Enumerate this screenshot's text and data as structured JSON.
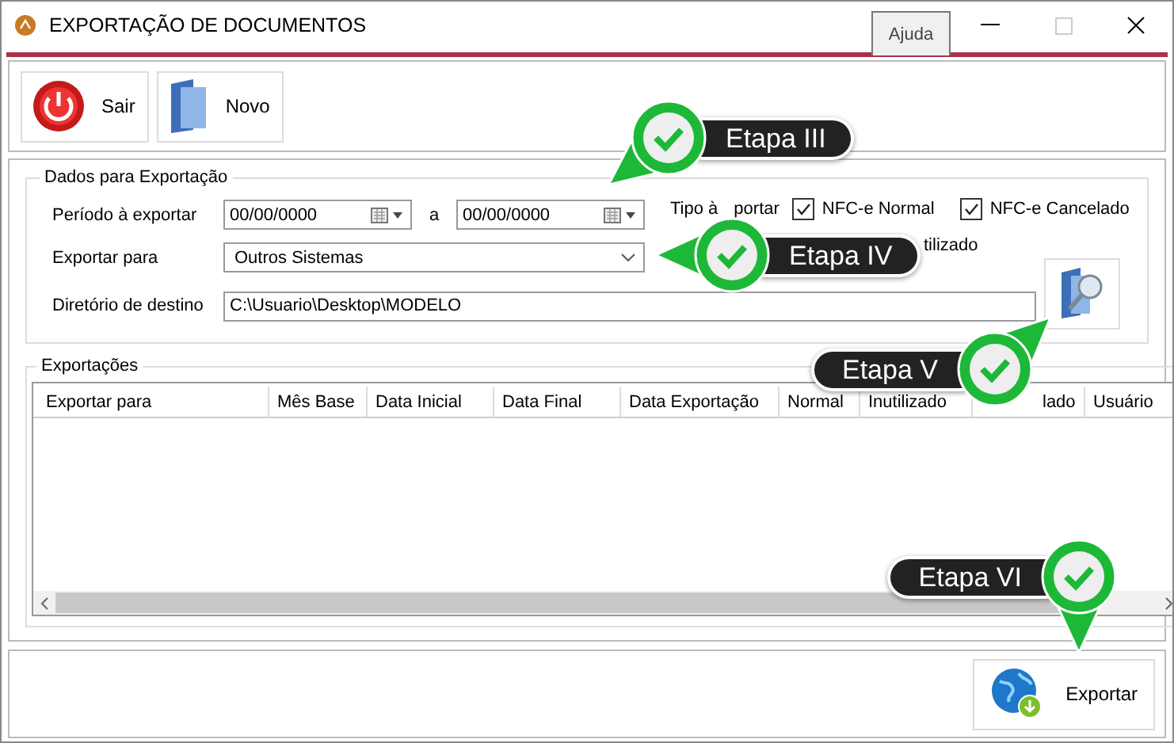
{
  "window": {
    "title": "EXPORTAÇÃO DE DOCUMENTOS",
    "help_tab": "Ajuda"
  },
  "toolbar": [
    {
      "label": "Sair",
      "kind": "exit"
    },
    {
      "label": "Novo",
      "kind": "new"
    }
  ],
  "export_data": {
    "title": "Dados para Exportação",
    "period_label": "Período à exportar",
    "date_from": "00/00/0000",
    "separator": "a",
    "date_to": "00/00/0000",
    "type_label": "Tipo à",
    "type_label_tail": "portar",
    "types": [
      {
        "label": "NFC-e Normal",
        "checked": true
      },
      {
        "label": "NFC-e Cancelado",
        "checked": true
      }
    ],
    "covered_type_tail": "tilizado",
    "target_label": "Exportar para",
    "target": "Outros Sistemas",
    "dir_label": "Diretório de destino",
    "dir": "C:\\Usuario\\Desktop\\MODELO"
  },
  "exports": {
    "title": "Exportações",
    "columns": [
      "Exportar para",
      "Mês Base",
      "Data Inicial",
      "Data Final",
      "Data Exportação",
      "Normal",
      "Inutilizado",
      "lado",
      "Usuário"
    ]
  },
  "footer": {
    "button": "Exportar"
  },
  "callouts": [
    {
      "label": "Etapa III"
    },
    {
      "label": "Etapa IV"
    },
    {
      "label": "Etapa V"
    },
    {
      "label": "Etapa VI"
    }
  ]
}
